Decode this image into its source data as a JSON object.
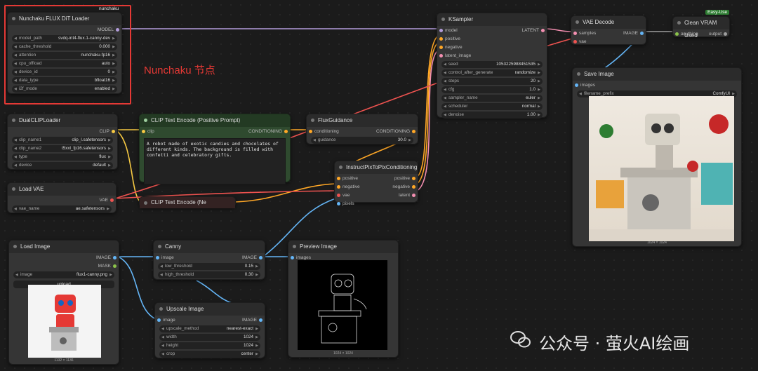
{
  "colors": {
    "clip": "#f5c842",
    "model": "#b39ddb",
    "latent": "#f48fb1",
    "cond": "#ffa726",
    "vae": "#ef5350",
    "image": "#64b5f6",
    "any": "#9e9e9e",
    "annotation": "#e53935"
  },
  "annotation": "Nunchaku 节点",
  "tags": {
    "nunchaku": "nunchaku",
    "easyuse": "Easy-Use"
  },
  "watermark": "公众号 · 萤火AI绘画",
  "nodes": {
    "flux_loader": {
      "title": "Nunchaku FLUX DiT Loader",
      "out": "MODEL",
      "widgets": [
        {
          "label": "model_path",
          "value": "svdq-int4-flux.1-canny-dev"
        },
        {
          "label": "cache_threshold",
          "value": "0.000"
        },
        {
          "label": "attention",
          "value": "nunchaku-fp16"
        },
        {
          "label": "cpu_offload",
          "value": "auto"
        },
        {
          "label": "device_id",
          "value": "0"
        },
        {
          "label": "data_type",
          "value": "bfloat16"
        },
        {
          "label": "i2f_mode",
          "value": "enabled"
        }
      ]
    },
    "dualclip": {
      "title": "DualCLIPLoader",
      "out": "CLIP",
      "widgets": [
        {
          "label": "clip_name1",
          "value": "clip_l.safetensors"
        },
        {
          "label": "clip_name2",
          "value": "t5xxl_fp16.safetensors"
        },
        {
          "label": "type",
          "value": "flux"
        },
        {
          "label": "device",
          "value": "default"
        }
      ]
    },
    "loadvae": {
      "title": "Load VAE",
      "out": "VAE",
      "widgets": [
        {
          "label": "vae_name",
          "value": "ae.safetensors"
        }
      ]
    },
    "clip_pos": {
      "title": "CLIP Text Encode (Positive Prompt)",
      "in": "clip",
      "out": "CONDITIONING",
      "text": "A robot made of exotic candies and chocolates of different kinds. The background is filled with confetti and celebratory gifts."
    },
    "clip_neg": {
      "title": "CLIP Text Encode (Ne"
    },
    "fluxguid": {
      "title": "FluxGuidance",
      "in": "conditioning",
      "out": "CONDITIONING",
      "widgets": [
        {
          "label": "guidance",
          "value": "30.0"
        }
      ]
    },
    "instruct": {
      "title": "InstructPixToPixConditioning",
      "ins": [
        "positive",
        "negative",
        "vae",
        "pixels"
      ],
      "outs": [
        "positive",
        "negative",
        "latent"
      ]
    },
    "ksampler": {
      "title": "KSampler",
      "ins": [
        "model",
        "positive",
        "negative",
        "latent_image"
      ],
      "out": "LATENT",
      "widgets": [
        {
          "label": "seed",
          "value": "1053225988451535"
        },
        {
          "label": "control_after_generate",
          "value": "randomize"
        },
        {
          "label": "steps",
          "value": "20"
        },
        {
          "label": "cfg",
          "value": "1.0"
        },
        {
          "label": "sampler_name",
          "value": "euler"
        },
        {
          "label": "scheduler",
          "value": "normal"
        },
        {
          "label": "denoise",
          "value": "1.00"
        }
      ]
    },
    "vaedecode": {
      "title": "VAE Decode",
      "ins": [
        "samples",
        "vae"
      ],
      "out": "IMAGE"
    },
    "cleanvram": {
      "title": "Clean VRAM Used",
      "in": "anything",
      "out": "output"
    },
    "saveimage": {
      "title": "Save Image",
      "in": "images",
      "widgets": [
        {
          "label": "filename_prefix",
          "value": "ComfyUI"
        }
      ],
      "caption": "1024 × 1024"
    },
    "loadimage": {
      "title": "Load Image",
      "outs": [
        "IMAGE",
        "MASK"
      ],
      "widgets": [
        {
          "label": "image",
          "value": "flux1-canny.png"
        }
      ],
      "button": "upload",
      "caption": "1132 × 1136"
    },
    "canny": {
      "title": "Canny",
      "in": "image",
      "out": "IMAGE",
      "widgets": [
        {
          "label": "low_threshold",
          "value": "0.15"
        },
        {
          "label": "high_threshold",
          "value": "0.30"
        }
      ]
    },
    "preview": {
      "title": "Preview Image",
      "in": "images",
      "caption": "1024 × 1024"
    },
    "upscale": {
      "title": "Upscale Image",
      "in": "image",
      "out": "IMAGE",
      "widgets": [
        {
          "label": "upscale_method",
          "value": "nearest-exact"
        },
        {
          "label": "width",
          "value": "1024"
        },
        {
          "label": "height",
          "value": "1024"
        },
        {
          "label": "crop",
          "value": "center"
        }
      ]
    }
  }
}
